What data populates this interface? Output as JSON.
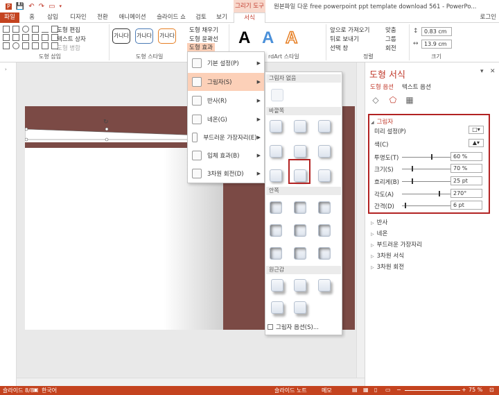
{
  "title_bar": {
    "contextual_group": "그리기 도구",
    "window_title": "원본파일 다운 free powerpoint ppt template download 561 - PowerPo..."
  },
  "tabs": [
    {
      "label": "파일"
    },
    {
      "label": "홈"
    },
    {
      "label": "삽입"
    },
    {
      "label": "디자인"
    },
    {
      "label": "전환"
    },
    {
      "label": "애니메이션"
    },
    {
      "label": "슬라이드 쇼"
    },
    {
      "label": "검토"
    },
    {
      "label": "보기"
    },
    {
      "label": "서식"
    }
  ],
  "login_label": "로그인",
  "ribbon": {
    "shape_insert": {
      "edit_shape": "도형 편집",
      "text_box": "텍스트 상자",
      "merge": "도형 병합",
      "label": "도형 삽입"
    },
    "shape_styles": {
      "preset_text": "가나다",
      "fill": "도형 채우기",
      "outline": "도형 윤곽선",
      "effects": "도형 효과",
      "label": "도형 스타일"
    },
    "wordart": {
      "label": "WordArt 스타일",
      "label_visible": "rdArt 스타일",
      "letters": [
        "A",
        "A",
        "A"
      ]
    },
    "arrange": {
      "bring_forward": "앞으로 가져오기",
      "send_backward": "뒤로 보내기",
      "selection_pane": "선택 창",
      "align": "맞춤",
      "group": "그룹",
      "rotate": "회전",
      "label": "정렬"
    },
    "size": {
      "height": "0.83 cm",
      "width": "13.9 cm",
      "label": "크기"
    }
  },
  "effects_menu": {
    "items": [
      {
        "label": "기본 설정(P)"
      },
      {
        "label": "그림자(S)"
      },
      {
        "label": "반사(R)"
      },
      {
        "label": "네온(G)"
      },
      {
        "label": "부드러운 가장자리(E)"
      },
      {
        "label": "입체 효과(B)"
      },
      {
        "label": "3차원 회전(D)"
      }
    ]
  },
  "shadow_gallery": {
    "no_shadow": "그림자 없음",
    "outer": "바깥쪽",
    "inner": "안쪽",
    "perspective": "원근감",
    "options": "그림자 옵션(S)..."
  },
  "format_pane": {
    "title": "도형 서식",
    "tab_shape_options": "도형 옵션",
    "tab_text_options": "텍스트 옵션",
    "shadow_header": "그림자",
    "preset_label": "미리 설정(P)",
    "color_label": "색(C)",
    "properties": [
      {
        "label": "투명도(T)",
        "value": "60 %",
        "level": 0.6
      },
      {
        "label": "크기(S)",
        "value": "70 %",
        "level": 0.2
      },
      {
        "label": "흐리게(B)",
        "value": "25 pt",
        "level": 0.2
      },
      {
        "label": "각도(A)",
        "value": "270°",
        "level": 0.75
      },
      {
        "label": "간격(D)",
        "value": "6 pt",
        "level": 0.05
      }
    ],
    "sections": [
      {
        "label": "반사"
      },
      {
        "label": "네온"
      },
      {
        "label": "부드러운 가장자리"
      },
      {
        "label": "3차원 서식"
      },
      {
        "label": "3차원 회전"
      }
    ]
  },
  "status_bar": {
    "slide_info": "슬라이드 8/8",
    "language": "한국어",
    "notes": "슬라이드 노트",
    "memo": "메모",
    "zoom": "75 %"
  },
  "colors": {
    "accent": "#c4431f",
    "slide_brown": "#7b4a45",
    "highlight": "#fcd0b8",
    "red_box": "#b22222"
  }
}
